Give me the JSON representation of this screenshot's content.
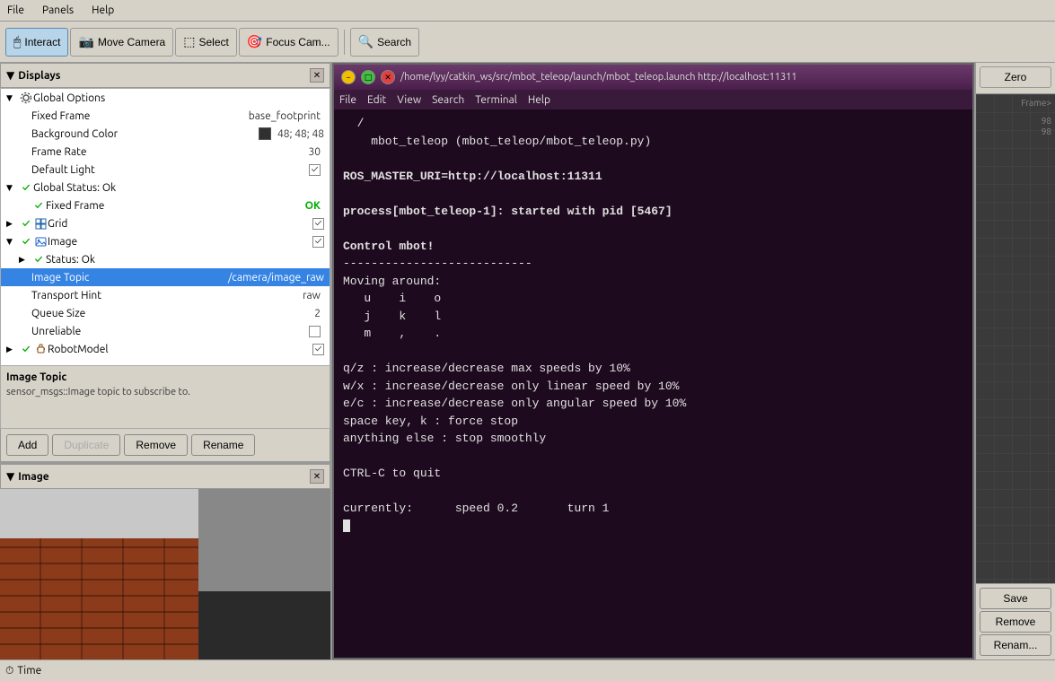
{
  "menu": {
    "items": [
      "File",
      "Panels",
      "Help"
    ]
  },
  "toolbar": {
    "interact_label": "Interact",
    "move_camera_label": "Move Camera",
    "select_label": "Select",
    "focus_camera_label": "Focus Cam...",
    "search_label": "Search"
  },
  "displays_panel": {
    "title": "Displays",
    "tree": [
      {
        "id": "global_options",
        "label": "Global Options",
        "level": 0,
        "expanded": true,
        "has_icon": true,
        "icon_type": "gear"
      },
      {
        "id": "fixed_frame_prop",
        "label": "Fixed Frame",
        "value": "base_footprint",
        "level": 1,
        "is_property": true
      },
      {
        "id": "background_color_prop",
        "label": "Background Color",
        "value": "48; 48; 48",
        "level": 1,
        "is_property": true,
        "has_swatch": true,
        "swatch_color": "#303030"
      },
      {
        "id": "frame_rate_prop",
        "label": "Frame Rate",
        "value": "30",
        "level": 1,
        "is_property": true
      },
      {
        "id": "default_light_prop",
        "label": "Default Light",
        "value": "",
        "level": 1,
        "is_property": true,
        "has_checkbox": true,
        "checked": true
      },
      {
        "id": "global_status",
        "label": "Global Status: Ok",
        "level": 0,
        "expanded": true,
        "has_check": true,
        "check_state": "ok"
      },
      {
        "id": "fixed_frame_status",
        "label": "Fixed Frame",
        "value": "OK",
        "level": 1,
        "is_property": true,
        "status_ok": true
      },
      {
        "id": "grid",
        "label": "Grid",
        "level": 0,
        "has_check": true,
        "check_state": "ok",
        "has_checkbox": true,
        "checked": true,
        "has_icon": true,
        "icon_type": "grid"
      },
      {
        "id": "image",
        "label": "Image",
        "level": 0,
        "expanded": true,
        "has_check": true,
        "check_state": "ok",
        "has_checkbox": true,
        "checked": true,
        "has_icon": true,
        "icon_type": "image"
      },
      {
        "id": "image_status",
        "label": "Status: Ok",
        "level": 1,
        "expanded": false,
        "has_check": true,
        "check_state": "ok"
      },
      {
        "id": "image_topic",
        "label": "Image Topic",
        "value": "/camera/image_raw",
        "level": 1,
        "is_property": true,
        "selected": true
      },
      {
        "id": "transport_hint",
        "label": "Transport Hint",
        "value": "raw",
        "level": 1,
        "is_property": true
      },
      {
        "id": "queue_size",
        "label": "Queue Size",
        "value": "2",
        "level": 1,
        "is_property": true
      },
      {
        "id": "unreliable",
        "label": "Unreliable",
        "value": "",
        "level": 1,
        "is_property": true,
        "has_checkbox": true,
        "checked": false
      },
      {
        "id": "robot_model",
        "label": "RobotModel",
        "level": 0,
        "has_check": true,
        "check_state": "ok",
        "has_checkbox": true,
        "checked": true,
        "has_icon": true,
        "icon_type": "robot"
      }
    ],
    "description_title": "Image Topic",
    "description_text": "sensor_msgs::Image topic to subscribe to.",
    "buttons": {
      "add": "Add",
      "duplicate": "Duplicate",
      "remove": "Remove",
      "rename": "Rename"
    }
  },
  "image_panel": {
    "title": "Image"
  },
  "terminal": {
    "title": "/home/lyy/catkin_ws/src/mbot_teleop/launch/mbot_teleop.launch http://localhost:11311",
    "menu_items": [
      "File",
      "Edit",
      "View",
      "Search",
      "Terminal",
      "Help"
    ],
    "lines": [
      "  /",
      "    mbot_teleop (mbot_teleop/mbot_teleop.py)",
      "",
      "ROS_MASTER_URI=http://localhost:11311",
      "",
      "process[mbot_teleop-1]: started with pid [5467]",
      "",
      "Control mbot!",
      "---------------------------",
      "Moving around:",
      "   u    i    o",
      "   j    k    l",
      "   m    ,    .",
      "",
      "q/z : increase/decrease max speeds by 10%",
      "w/x : increase/decrease only linear speed by 10%",
      "e/c : increase/decrease only angular speed by 10%",
      "space key, k : force stop",
      "anything else : stop smoothly",
      "",
      "CTRL-C to quit",
      "",
      "currently:      speed 0.2       turn 1",
      ""
    ]
  },
  "right_sidebar": {
    "zero_button": "Zero",
    "frame_label": "Frame>",
    "val1": "98",
    "val2": "98",
    "save_button": "Save",
    "remove_button": "Remove",
    "rename_button": "Renam..."
  },
  "status_bar": {
    "label": "Time"
  }
}
